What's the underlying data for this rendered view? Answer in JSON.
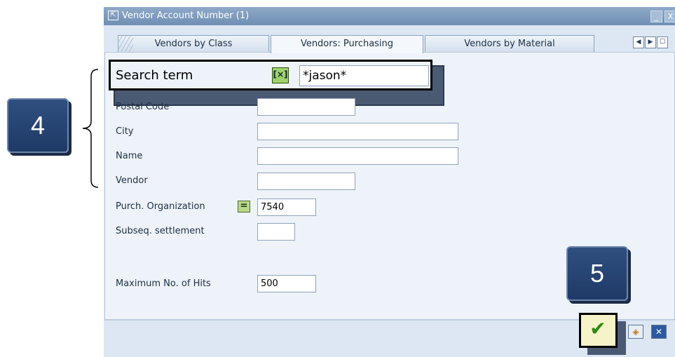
{
  "window": {
    "title": "Vendor Account Number (1)",
    "window_icon": "dialog-icon",
    "minimize_glyph": "_",
    "close_glyph": "X"
  },
  "tabs": [
    {
      "label": "Vendors by Class",
      "active": false
    },
    {
      "label": "Vendors: Purchasing",
      "active": true
    },
    {
      "label": "Vendors by Material",
      "active": false
    }
  ],
  "tab_nav": {
    "left_glyph": "◀",
    "right_glyph": "▶",
    "list_glyph": "☐"
  },
  "search_term": {
    "label": "Search term",
    "operator_glyph": "[×]",
    "value": "*jason*"
  },
  "fields": [
    {
      "label": "Postal Code",
      "value": ""
    },
    {
      "label": "City",
      "value": ""
    },
    {
      "label": "Name",
      "value": ""
    },
    {
      "label": "Vendor",
      "value": ""
    },
    {
      "label": "Purch. Organization",
      "value": "7540",
      "operator_glyph": "="
    },
    {
      "label": "Subseq. settlement",
      "value": ""
    },
    {
      "label": "Maximum No. of Hits",
      "value": "500"
    }
  ],
  "callouts": {
    "step4": "4",
    "step5": "5"
  },
  "footer": {
    "ok_glyph": "✔",
    "multi_glyph": "◈",
    "cancel_glyph": "✕"
  },
  "colors": {
    "accent": "#2f4f80",
    "title_bar": "#7d99bd",
    "panel": "#eef3f9",
    "ok_check": "#2b8a12"
  }
}
